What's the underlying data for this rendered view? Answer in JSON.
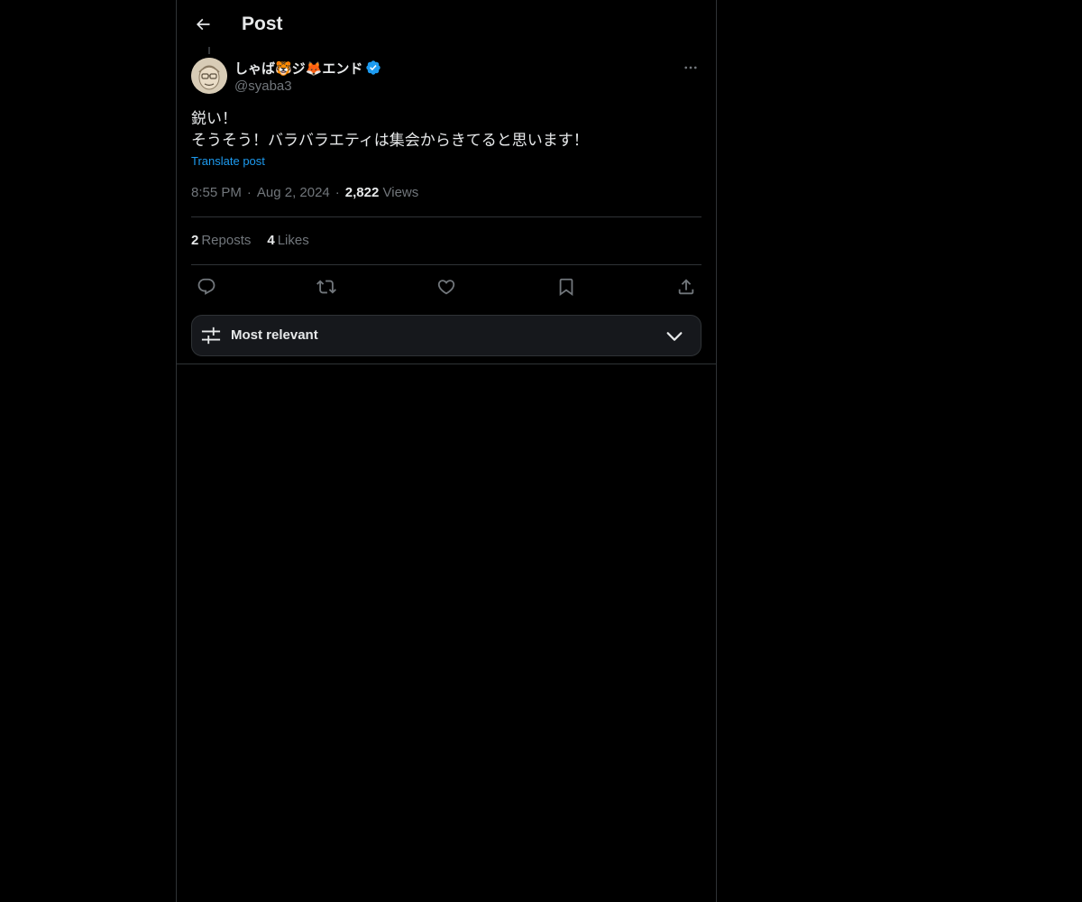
{
  "header": {
    "title": "Post",
    "back_icon": "arrow-left-icon"
  },
  "post": {
    "display_name": "しゃば🐯ジ🦊エンド",
    "handle": "@syaba3",
    "verified": true,
    "text_lines": [
      "鋭い！",
      "そうそう！バラバラエティは集会からきてると思います！"
    ],
    "translate_label": "Translate post",
    "time": "8:55 PM",
    "date": "Aug 2, 2024",
    "separator": "·",
    "views_count": "2,822",
    "views_label": "Views",
    "reposts_count": "2",
    "reposts_label": "Reposts",
    "likes_count": "4",
    "likes_label": "Likes"
  },
  "sort": {
    "label": "Most relevant"
  },
  "colors": {
    "background": "#000000",
    "text": "#e7e9ea",
    "muted": "#71767b",
    "accent": "#1d9bf0",
    "border": "#2f3336"
  }
}
